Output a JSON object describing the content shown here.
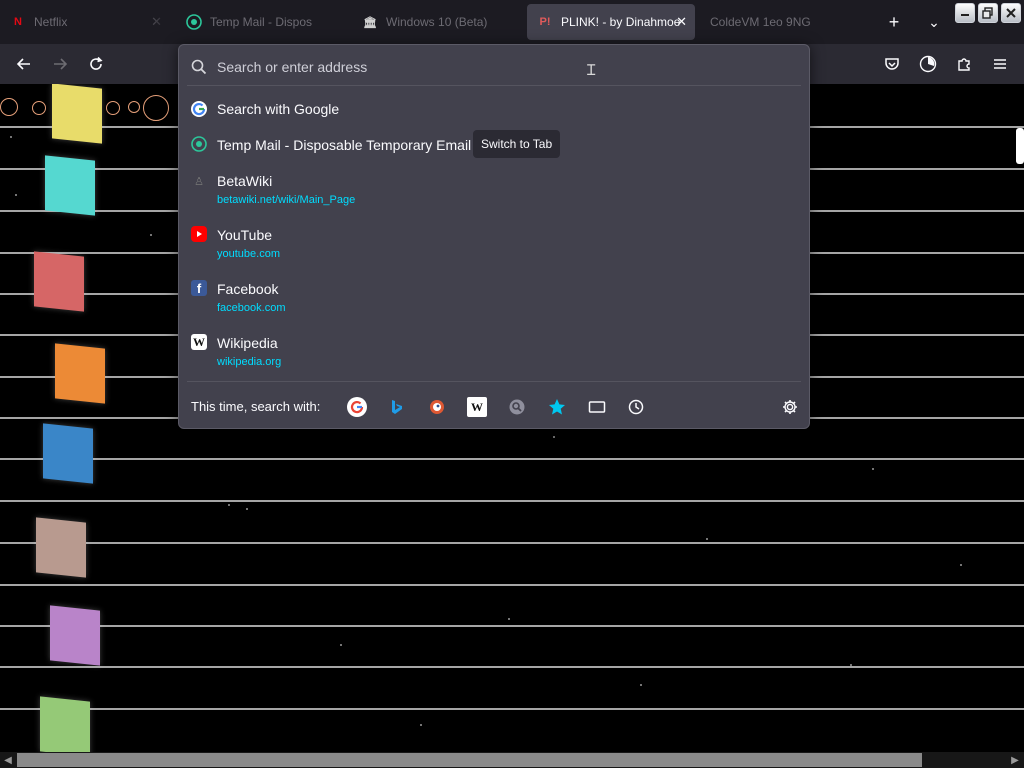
{
  "tabs": [
    {
      "label": "Netflix",
      "icon": "netflix-icon",
      "color": "#e50914"
    },
    {
      "label": "Temp Mail - Dispos",
      "icon": "temp-mail-icon",
      "color": "#2cc79b"
    },
    {
      "label": "Windows 10 (Beta)",
      "icon": "betawiki-icon",
      "color": "#d0d0d0"
    },
    {
      "label": "PLINK! - by Dinahmoe",
      "icon": "plink-icon",
      "color": "#e05b5b"
    },
    {
      "label": "ColdeVM 1eo 9NG",
      "icon": "",
      "color": ""
    }
  ],
  "urlbar": {
    "placeholder": "Search or enter address"
  },
  "results": [
    {
      "title": "Search with Google",
      "url": "",
      "icon": "google-icon"
    },
    {
      "title": "Temp Mail - Disposable Temporary Email",
      "url": "",
      "icon": "temp-mail-icon",
      "badge": "Switch to Tab"
    },
    {
      "title": "BetaWiki",
      "url": "betawiki.net/wiki/Main_Page",
      "icon": "betawiki-icon"
    },
    {
      "title": "YouTube",
      "url": "youtube.com",
      "icon": "youtube-icon"
    },
    {
      "title": "Facebook",
      "url": "facebook.com",
      "icon": "facebook-icon"
    },
    {
      "title": "Wikipedia",
      "url": "wikipedia.org",
      "icon": "wikipedia-icon"
    }
  ],
  "oneoff": {
    "label": "This time, search with:",
    "engines": [
      "google-icon",
      "bing-icon",
      "duckduckgo-icon",
      "wikipedia-icon",
      "search-engine-icon",
      "bookmarks-star-icon",
      "tabs-icon",
      "history-clock-icon"
    ]
  },
  "colors": {
    "accent_url": "#00ddff",
    "popup_bg": "#42414d",
    "toolbar_bg": "#2b2a33",
    "tabstrip_bg": "#1c1b22"
  }
}
